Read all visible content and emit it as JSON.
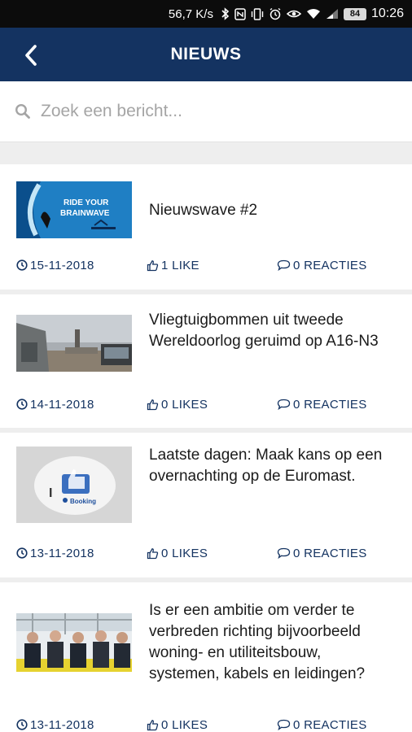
{
  "status_bar": {
    "speed": "56,7 K/s",
    "battery": "84",
    "time": "10:26"
  },
  "header": {
    "title": "NIEUWS",
    "back_icon": "chevron-left-icon"
  },
  "search": {
    "placeholder": "Zoek een bericht...",
    "value": "",
    "icon": "search-icon"
  },
  "colors": {
    "header_bg": "#143361",
    "meta_text": "#143361",
    "divider": "#eeeeee"
  },
  "news": [
    {
      "title": "Nieuwswave #2",
      "thumb_text_1": "RIDE YOUR",
      "thumb_text_2": "BRAINWAVE",
      "date": "15-11-2018",
      "likes": "1 LIKE",
      "reactions": "0 REACTIES"
    },
    {
      "title": "Vliegtuigbommen uit tweede Wereldoorlog geruimd op A16-N3",
      "date": "14-11-2018",
      "likes": "0 LIKES",
      "reactions": "0 REACTIES"
    },
    {
      "title": "Laatste dagen: Maak kans op een overnachting op de Euromast.",
      "thumb_text_1": "I",
      "thumb_text_2": "Booking",
      "date": "13-11-2018",
      "likes": "0 LIKES",
      "reactions": "0 REACTIES"
    },
    {
      "title": "Is er een ambitie om verder te verbreden richting bijvoorbeeld woning- en utiliteitsbouw, systemen, kabels en leidingen?",
      "date": "13-11-2018",
      "likes": "0 LIKES",
      "reactions": "0 REACTIES"
    }
  ]
}
